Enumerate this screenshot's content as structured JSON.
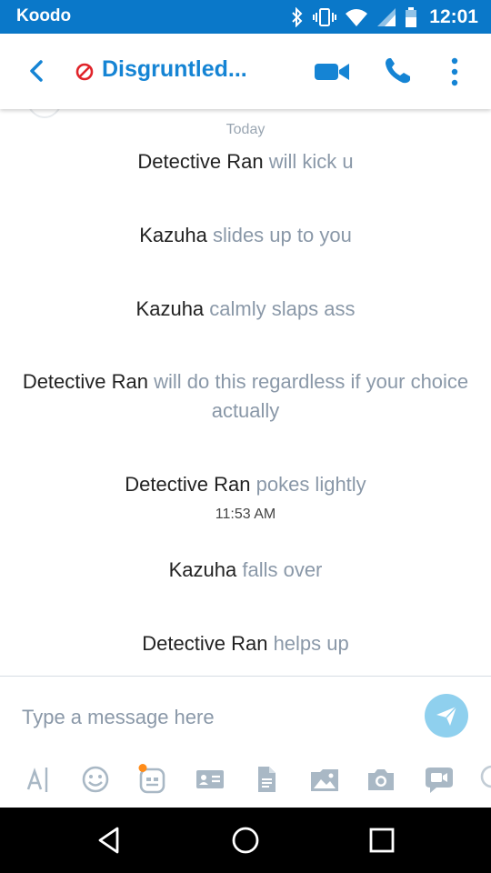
{
  "status_bar": {
    "carrier": "Koodo",
    "time": "12:01"
  },
  "header": {
    "title": "Disgruntled..."
  },
  "chat": {
    "day_label": "Today",
    "messages": [
      {
        "sender": "Detective Ran",
        "text": "will kick u"
      },
      {
        "sender": "Kazuha",
        "text": "slides up to you"
      },
      {
        "sender": "Kazuha",
        "text": "calmly slaps ass"
      },
      {
        "sender": "Detective Ran",
        "text": "will do this regardless if your choice actually"
      },
      {
        "sender": "Detective Ran",
        "text": "pokes lightly"
      },
      {
        "sender": "Kazuha",
        "text": "falls over"
      },
      {
        "sender": "Detective Ran",
        "text": "helps up"
      }
    ],
    "time_label": "11:53 AM"
  },
  "composer": {
    "placeholder": "Type a message here"
  },
  "toolbar": {
    "icons": [
      "text-format-icon",
      "emoticon-icon",
      "mojis-icon",
      "contact-card-icon",
      "file-icon",
      "photo-album-icon",
      "camera-icon",
      "video-message-icon"
    ]
  },
  "colors": {
    "status_bar": "#0a78c9",
    "accent": "#1584d4",
    "block_red": "#e0242a",
    "muted_text": "#8a98a8",
    "send_button": "#8fd0ee",
    "emoji_dot": "#ff8c1a"
  }
}
